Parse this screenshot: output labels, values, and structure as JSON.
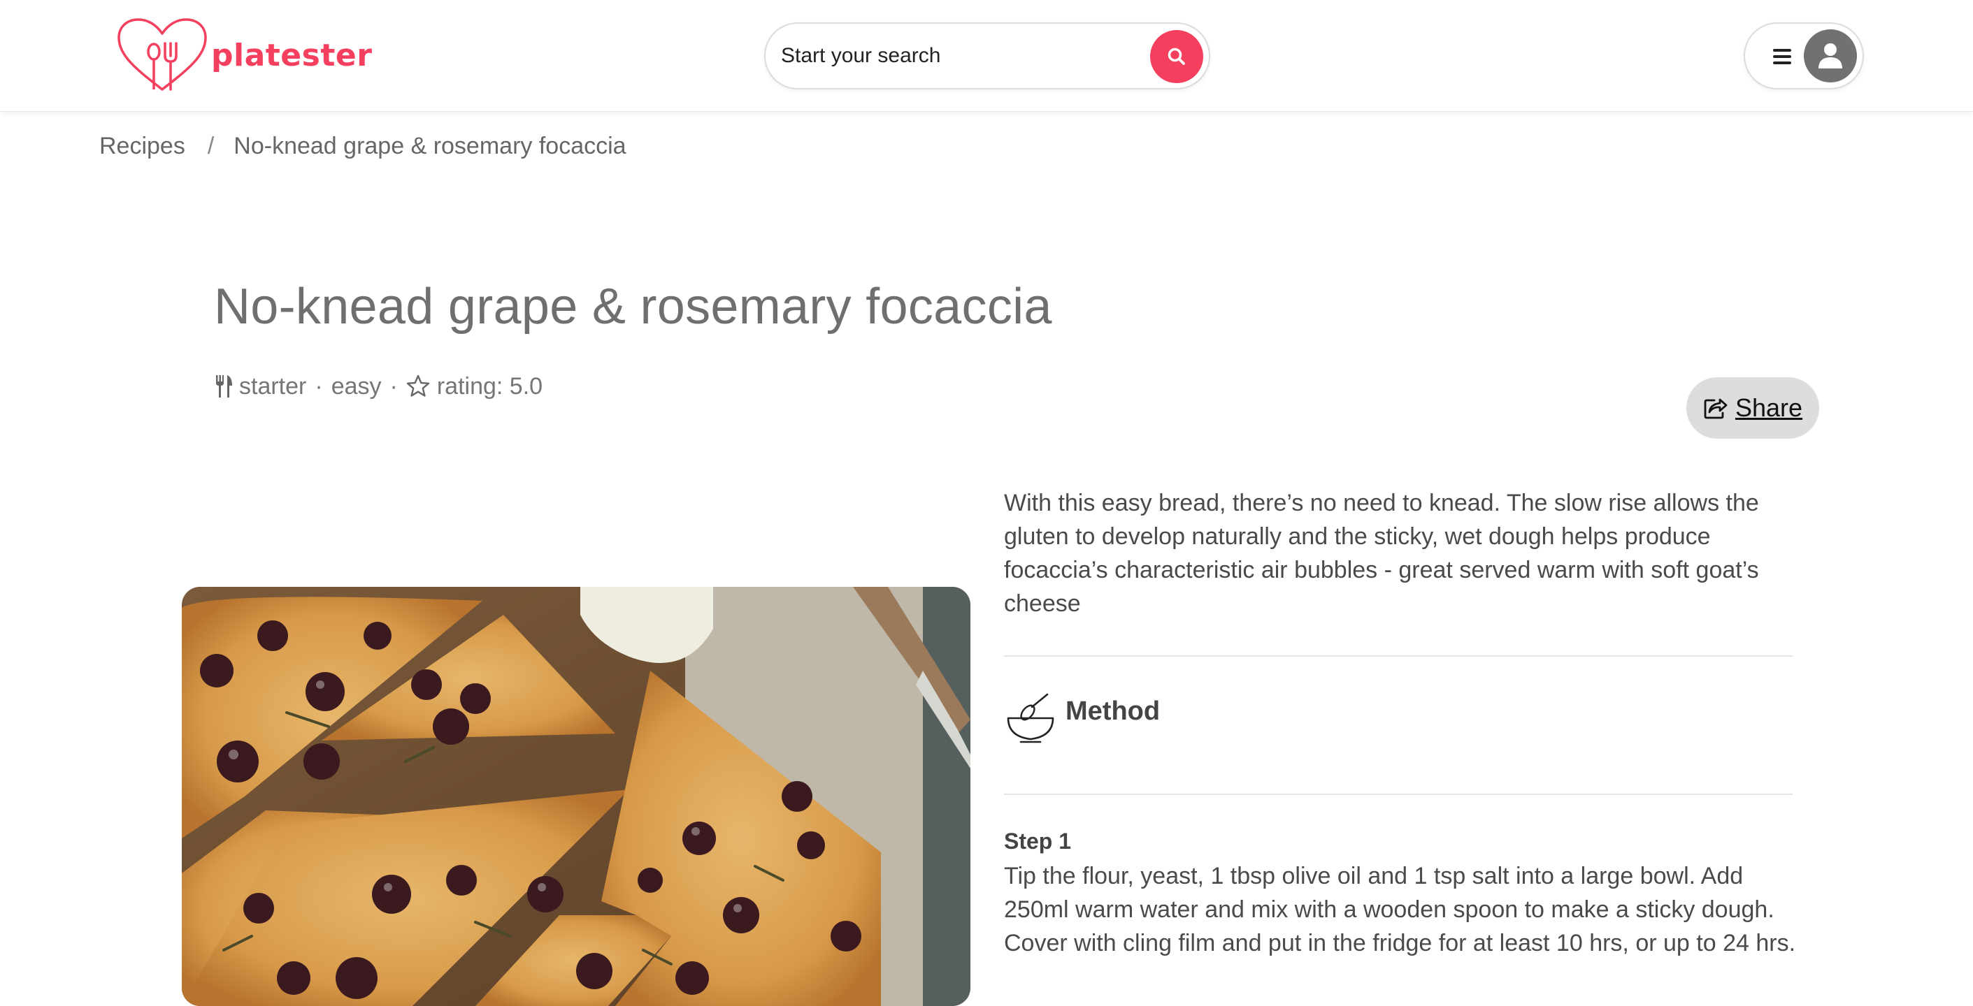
{
  "brand": {
    "name": "platester",
    "accent_color": "#f43f5e",
    "logo_icon": "heart-fork-icon"
  },
  "search": {
    "placeholder": "Start your search",
    "button_icon": "search-icon"
  },
  "user_menu": {
    "menu_icon": "hamburger-menu-icon",
    "avatar_icon": "user-avatar-icon"
  },
  "breadcrumb": {
    "items": [
      "Recipes",
      "No-knead grape & rosemary focaccia"
    ],
    "separator": "/"
  },
  "recipe": {
    "title": "No-knead grape & rosemary focaccia",
    "meta": {
      "course_icon": "cutlery-icon",
      "course": "starter",
      "difficulty": "easy",
      "rating_icon": "star-icon",
      "rating_text": "rating: 5.0",
      "separator": "·"
    },
    "share_label": "Share",
    "description": "With this easy bread, there’s no need to knead. The slow rise allows the gluten to develop naturally and the sticky, wet dough helps produce focaccia’s characteristic air bubbles - great served warm with soft goat’s cheese",
    "method_title": "Method",
    "method_icon": "whisk-bowl-icon",
    "steps": [
      {
        "label": "Step 1",
        "text": "Tip the flour, yeast, 1 tbsp olive oil and 1 tsp salt into a large bowl. Add 250ml warm water and mix with a wooden spoon to make a sticky dough. Cover with cling film and put in the fridge for at least 10 hrs, or up to 24 hrs."
      }
    ]
  }
}
